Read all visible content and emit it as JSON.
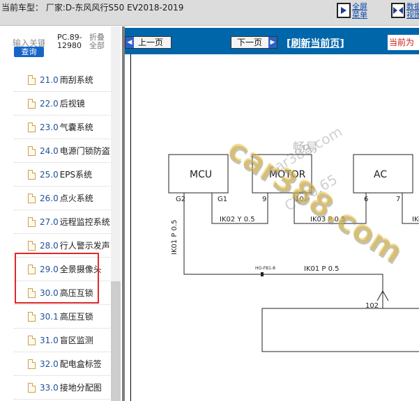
{
  "header": {
    "title": "当前车型：  厂家:D-东风风行S50 EV2018-2019",
    "fullscreen_label": "全屏菜单",
    "data_label": "数据视图"
  },
  "sidebar": {
    "keyword_label": "输入关键词",
    "query_button": "查询",
    "pc_code": "PC.89-12980",
    "fold_label": "折叠全部",
    "items": [
      {
        "num": "21.0",
        "label": "雨刮系统"
      },
      {
        "num": "22.0",
        "label": "后视镜"
      },
      {
        "num": "23.0",
        "label": "气囊系统"
      },
      {
        "num": "24.0",
        "label": "电源门锁防盗"
      },
      {
        "num": "25.0",
        "label": "EPS系统"
      },
      {
        "num": "26.0",
        "label": "点火系统"
      },
      {
        "num": "27.0",
        "label": "远程监控系统"
      },
      {
        "num": "28.0",
        "label": "行人警示发声"
      },
      {
        "num": "29.0",
        "label": "全景摄像头"
      },
      {
        "num": "30.0",
        "label": "高压互锁"
      },
      {
        "num": "30.1",
        "label": "高压互锁"
      },
      {
        "num": "31.0",
        "label": "盲区监测"
      },
      {
        "num": "32.0",
        "label": "配电盒标签"
      },
      {
        "num": "33.0",
        "label": "接地分配图"
      }
    ]
  },
  "nav": {
    "prev_label": "上一页",
    "next_label": "下一页",
    "refresh_label": "[刷新当前页]",
    "current_label": "当前为"
  },
  "diagram": {
    "boxes": [
      "MCU",
      "MOTOR",
      "AC"
    ],
    "pins": [
      "G2",
      "G1",
      "9",
      "10",
      "6",
      "7"
    ],
    "wires": [
      "IK02 Y 0.5",
      "IK03 P 0.5",
      "IK01 P 0.5",
      "IK01 P 0.5",
      "IKO"
    ],
    "connector": "HO-FB1-8",
    "connector_pin": "102"
  },
  "watermark": {
    "main": "car388.com",
    "cn": "畅易",
    "small": "car388.com",
    "code": "CY20.65"
  }
}
